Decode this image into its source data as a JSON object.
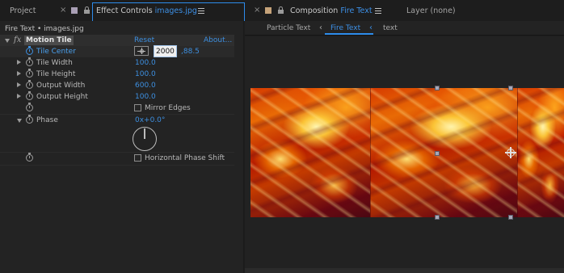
{
  "left_panel": {
    "tabs": {
      "project_label": "Project",
      "close_glyph": "×",
      "effect_controls_prefix": "Effect Controls ",
      "effect_controls_layer": "images.jpg"
    },
    "layer_path": "Fire Text • images.jpg",
    "effect": {
      "fx_glyph": "fx",
      "name": "Motion Tile",
      "reset_label": "Reset",
      "about_label": "About..."
    },
    "properties": {
      "tile_center": {
        "label": "Tile Center",
        "x_value": "2000",
        "y_value": ",88.5"
      },
      "tile_width": {
        "label": "Tile Width",
        "value": "100.0"
      },
      "tile_height": {
        "label": "Tile Height",
        "value": "100.0"
      },
      "output_width": {
        "label": "Output Width",
        "value": "600.0"
      },
      "output_height": {
        "label": "Output Height",
        "value": "100.0"
      },
      "mirror_edges": {
        "label": "Mirror Edges",
        "checked": false
      },
      "phase": {
        "label": "Phase",
        "value": "0x+0.0°",
        "dial_angle_deg": 0
      },
      "horizontal_phase_shift": {
        "label": "Horizontal Phase Shift",
        "checked": false
      }
    }
  },
  "right_panel": {
    "tabs": {
      "close_glyph": "×",
      "composition_prefix": "Composition ",
      "composition_name": "Fire Text",
      "layer_label": "Layer (none)"
    },
    "breadcrumbs": {
      "items": [
        "Particle Text",
        "Fire Text",
        "text"
      ],
      "separator_glyph": "‹",
      "active_index": 1
    }
  },
  "colors": {
    "accent_blue": "#3d90e6",
    "panel_bg": "#232323",
    "viewer_bg": "#222222",
    "project_swatch": "#a99fb5",
    "composition_swatch": "#c6a37a"
  },
  "icons": {
    "lock": "lock-icon",
    "panel_menu": "hamburger-menu-icon",
    "stopwatch": "stopwatch-icon",
    "crosshair": "crosshair-icon",
    "anchor": "anchor-point-icon"
  }
}
